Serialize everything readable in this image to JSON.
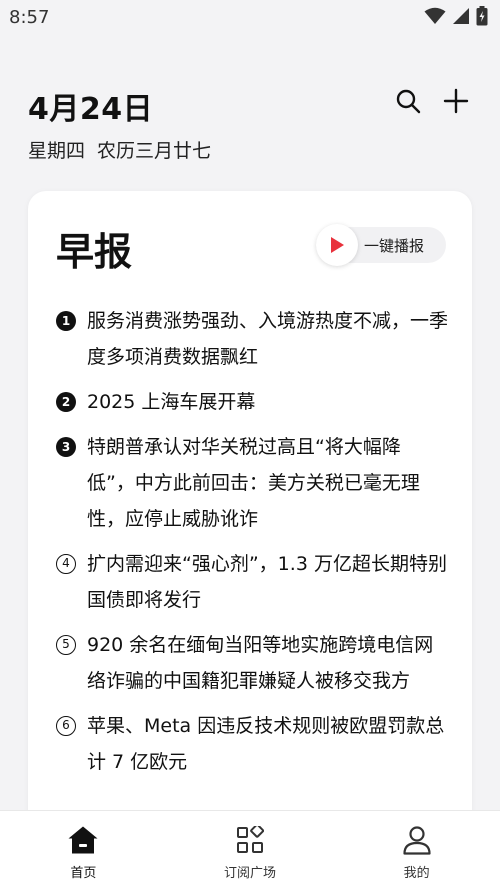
{
  "status": {
    "time": "8:57"
  },
  "header": {
    "date": "4月24日",
    "lunar": "星期四 农历三月廿七"
  },
  "card": {
    "title": "早报",
    "play_label": "一键播报",
    "news": [
      {
        "num": "1",
        "text": "服务消费涨势强劲、入境游热度不减，一季度多项消费数据飘红"
      },
      {
        "num": "2",
        "text": "2025 上海车展开幕"
      },
      {
        "num": "3",
        "text": "特朗普承认对华关税过高且“将大幅降低”，中方此前回击：美方关税已毫无理性，应停止威胁讹诈"
      },
      {
        "num": "4",
        "text": "扩内需迎来“强心剂”，1.3 万亿超长期特别国债即将发行"
      },
      {
        "num": "5",
        "text": "920 余名在缅甸当阳等地实施跨境电信网络诈骗的中国籍犯罪嫌疑人被移交我方"
      },
      {
        "num": "6",
        "text": "苹果、Meta 因违反技术规则被欧盟罚款总计 7 亿欧元"
      }
    ]
  },
  "tabs": [
    {
      "label": "首页",
      "icon": "home-icon"
    },
    {
      "label": "订阅广场",
      "icon": "grid-icon"
    },
    {
      "label": "我的",
      "icon": "person-icon"
    }
  ],
  "colors": {
    "accent_red": "#e8323c",
    "text": "#111111",
    "background": "#f3f3f5"
  }
}
